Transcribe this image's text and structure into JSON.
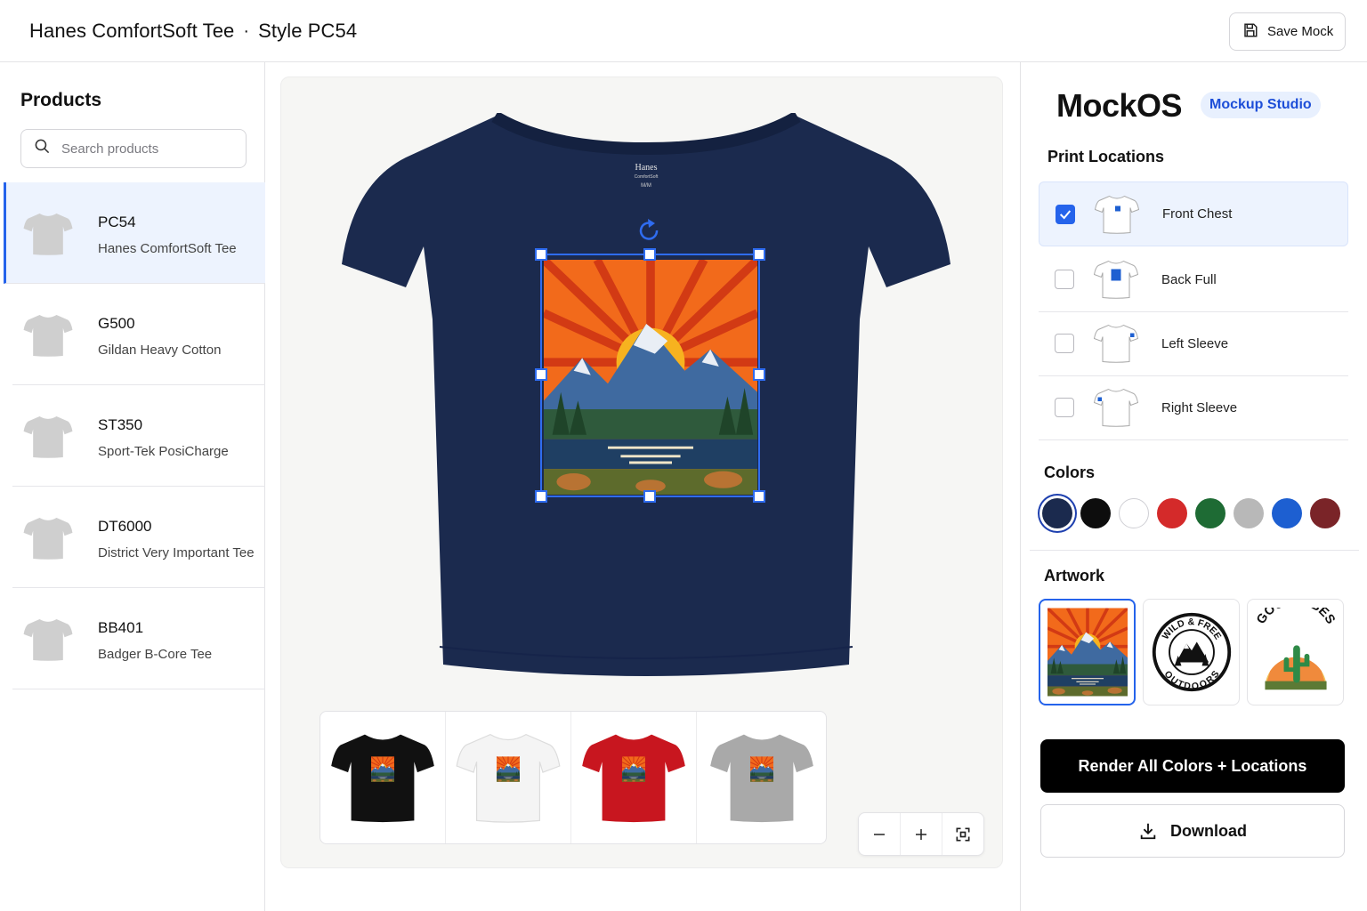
{
  "header": {
    "product_name": "Hanes ComfortSoft Tee",
    "separator": "·",
    "style": "Style PC54",
    "save_label": "Save Mock"
  },
  "sidebar": {
    "title": "Products",
    "search_placeholder": "Search products",
    "products": [
      {
        "code": "PC54",
        "name": "Hanes ComfortSoft Tee"
      },
      {
        "code": "G500",
        "name": "Gildan Heavy Cotton"
      },
      {
        "code": "ST350",
        "name": "Sport-Tek PosiCharge"
      },
      {
        "code": "DT6000",
        "name": "District Very Important Tee"
      },
      {
        "code": "BB401",
        "name": "Badger B-Core Tee"
      }
    ]
  },
  "canvas": {
    "label_brand": "Hanes",
    "label_line": "ComfortSoft",
    "label_size": "M/M",
    "shirt_color": "#1b2a4e",
    "variants": [
      "black",
      "white",
      "red",
      "heather-gray"
    ]
  },
  "panel": {
    "brand": "MockOS",
    "badge": "Mockup Studio",
    "print_locations_title": "Print Locations",
    "locations": [
      {
        "label": "Front Chest",
        "checked": true
      },
      {
        "label": "Back Full",
        "checked": false
      },
      {
        "label": "Left Sleeve",
        "checked": false
      },
      {
        "label": "Right Sleeve",
        "checked": false
      }
    ],
    "colors_title": "Colors",
    "colors": [
      "#1b2a4e",
      "#0d0d0d",
      "#ffffff",
      "#d42a2a",
      "#1e6b34",
      "#b8b8b8",
      "#1d5fd1",
      "#7a2428"
    ],
    "artwork_title": "Artwork",
    "artwork_texts": {
      "badge_top": "WILD & FREE",
      "badge_bottom": "OUTDOORS",
      "vibes": "GOOD VIBES"
    },
    "render_label": "Render All Colors + Locations",
    "download_label": "Download"
  }
}
